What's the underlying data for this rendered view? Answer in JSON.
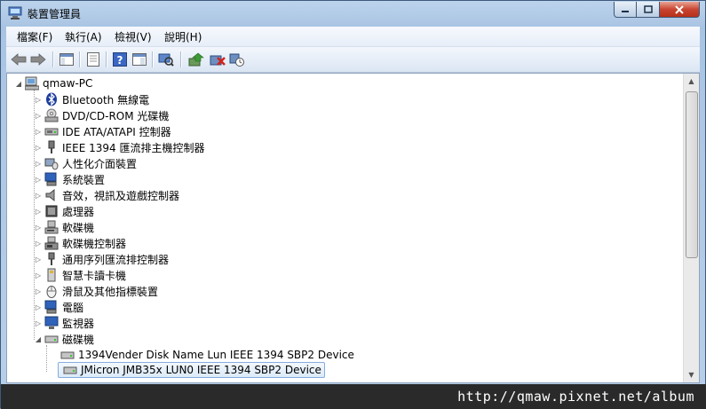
{
  "window": {
    "title": "裝置管理員",
    "buttons": {
      "minimize": "minimize-button",
      "maximize": "maximize-button",
      "close": "close-button"
    }
  },
  "menubar": [
    "檔案(F)",
    "執行(A)",
    "檢視(V)",
    "說明(H)"
  ],
  "toolbar": [
    "back-icon",
    "forward-icon",
    "show-hide-tree-icon",
    "properties-icon",
    "help-icon",
    "action-pane-icon",
    "scan-hardware-icon",
    "update-driver-icon",
    "uninstall-icon",
    "disable-icon"
  ],
  "tree": {
    "root": "qmaw-PC",
    "categories": [
      {
        "label": "Bluetooth 無線電",
        "icon": "bluetooth-icon"
      },
      {
        "label": "DVD/CD-ROM 光碟機",
        "icon": "optical-drive-icon"
      },
      {
        "label": "IDE ATA/ATAPI 控制器",
        "icon": "ide-controller-icon"
      },
      {
        "label": "IEEE 1394 匯流排主機控制器",
        "icon": "firewire-icon"
      },
      {
        "label": "人性化介面裝置",
        "icon": "hid-icon"
      },
      {
        "label": "系統裝置",
        "icon": "system-devices-icon"
      },
      {
        "label": "音效，視訊及遊戲控制器",
        "icon": "sound-icon"
      },
      {
        "label": "處理器",
        "icon": "processor-icon"
      },
      {
        "label": "軟碟機",
        "icon": "floppy-drive-icon"
      },
      {
        "label": "軟碟機控制器",
        "icon": "floppy-controller-icon"
      },
      {
        "label": "通用序列匯流排控制器",
        "icon": "usb-icon"
      },
      {
        "label": "智慧卡讀卡機",
        "icon": "smart-card-icon"
      },
      {
        "label": "滑鼠及其他指標裝置",
        "icon": "mouse-icon"
      },
      {
        "label": "電腦",
        "icon": "computer-icon"
      },
      {
        "label": "監視器",
        "icon": "monitor-icon"
      },
      {
        "label": "磁碟機",
        "icon": "disk-drive-icon",
        "expanded": true
      }
    ],
    "disk_children": [
      {
        "label": "1394Vender Disk Name Lun IEEE 1394 SBP2 Device",
        "selected": false
      },
      {
        "label": "JMicron  JMB35x LUN0 IEEE 1394 SBP2 Device",
        "selected": true
      }
    ]
  },
  "watermark": "http://qmaw.pixnet.net/album"
}
